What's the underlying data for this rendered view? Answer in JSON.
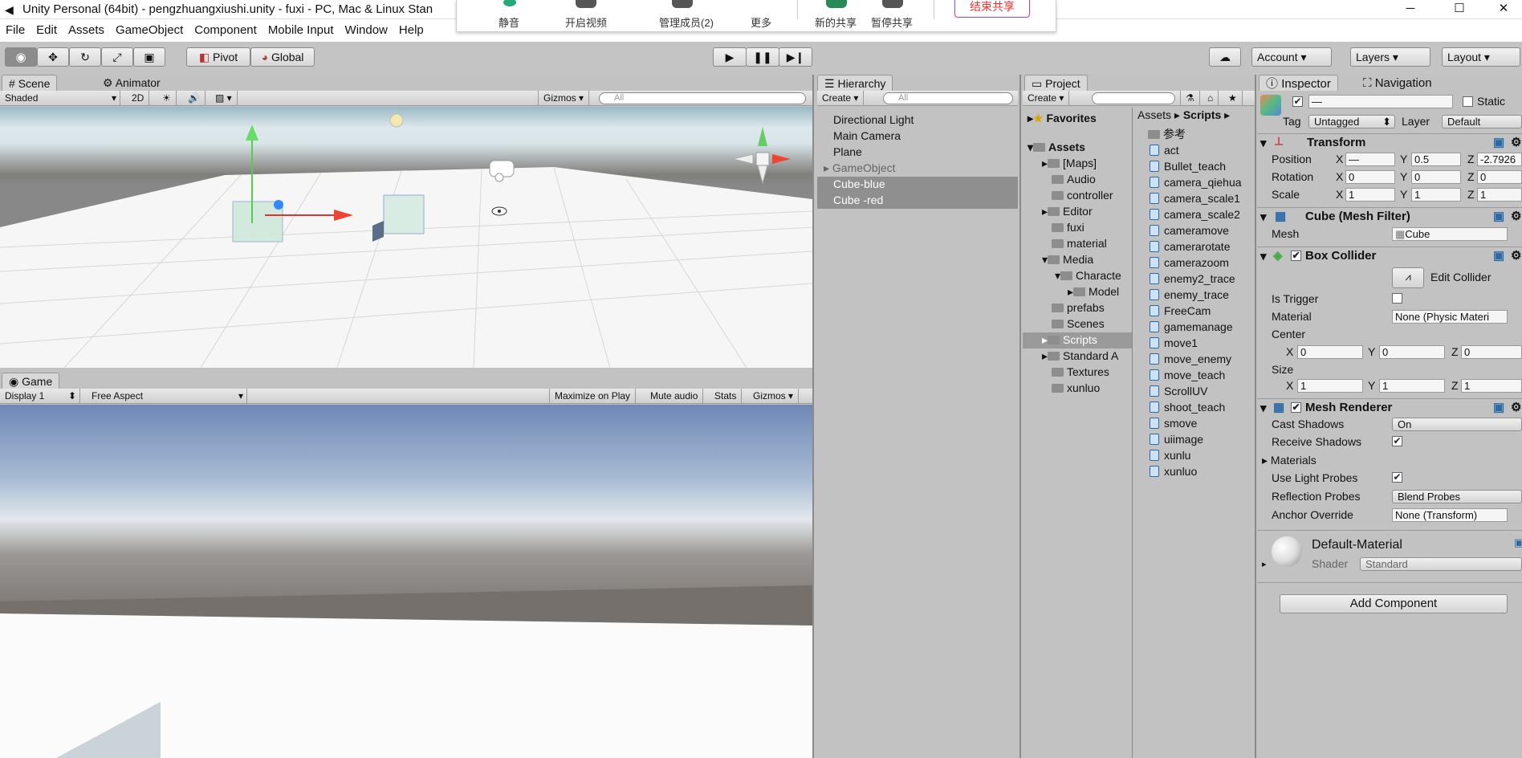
{
  "window": {
    "title": "Unity Personal (64bit) - pengzhuangxiushi.unity - fuxi - PC, Mac & Linux Stan",
    "minimize": "─",
    "maximize": "☐",
    "close": "✕"
  },
  "menu": [
    "File",
    "Edit",
    "Assets",
    "GameObject",
    "Component",
    "Mobile Input",
    "Window",
    "Help"
  ],
  "meeting": {
    "mute": "静音",
    "video": "开启视频",
    "members": "管理成员(2)",
    "more": "更多",
    "new_share": "新的共享",
    "pause_share": "暂停共享",
    "end_share": "结束共享"
  },
  "toolbar": {
    "pivot": "Pivot",
    "global": "Global",
    "account": "Account",
    "layers": "Layers",
    "layout": "Layout",
    "cloud_icon": "cloud-icon"
  },
  "scene": {
    "tab": "Scene",
    "animator_tab": "Animator",
    "shading": "Shaded",
    "mode2d": "2D",
    "gizmos": "Gizmos",
    "search_placeholder": "All"
  },
  "game": {
    "tab": "Game",
    "display": "Display 1",
    "aspect": "Free Aspect",
    "maximize": "Maximize on Play",
    "mute": "Mute audio",
    "stats": "Stats",
    "gizmos": "Gizmos"
  },
  "hierarchy": {
    "tab": "Hierarchy",
    "create": "Create",
    "search_placeholder": "All",
    "items": [
      "Directional Light",
      "Main Camera",
      "Plane",
      "GameObject",
      "Cube-blue",
      "Cube -red"
    ]
  },
  "project": {
    "tab": "Project",
    "create": "Create",
    "favorites": "Favorites",
    "assets": "Assets",
    "folders": [
      "[Maps]",
      "Audio",
      "controller",
      "Editor",
      "fuxi",
      "material",
      "Media",
      "Characte",
      "Model",
      "prefabs",
      "Scenes",
      "Scripts",
      "Standard A",
      "Textures",
      "xunluo"
    ],
    "breadcrumb": [
      "Assets",
      "Scripts"
    ],
    "files": [
      "参考",
      "act",
      "Bullet_teach",
      "camera_qiehua",
      "camera_scale1",
      "camera_scale2",
      "cameramove",
      "camerarotate",
      "camerazoom",
      "enemy2_trace",
      "enemy_trace",
      "FreeCam",
      "gamemanage",
      "move1",
      "move_enemy",
      "move_teach",
      "ScrollUV",
      "shoot_teach",
      "smove",
      "uiimage",
      "xunlu",
      "xunluo"
    ]
  },
  "inspector": {
    "tab": "Inspector",
    "nav_tab": "Navigation",
    "name_value": "—",
    "static": "Static",
    "tag_label": "Tag",
    "tag": "Untagged",
    "layer_label": "Layer",
    "layer": "Default",
    "transform": {
      "title": "Transform",
      "position": "Position",
      "rotation": "Rotation",
      "scale": "Scale",
      "pos": [
        "—",
        "0.5",
        "-2.7926"
      ],
      "rot": [
        "0",
        "0",
        "0"
      ],
      "scl": [
        "1",
        "1",
        "1"
      ]
    },
    "meshfilter": {
      "title": "Cube (Mesh Filter)",
      "mesh_label": "Mesh",
      "mesh": "Cube"
    },
    "boxcollider": {
      "title": "Box Collider",
      "edit": "Edit Collider",
      "is_trigger": "Is Trigger",
      "material_label": "Material",
      "material": "None (Physic Materi",
      "center": "Center",
      "size": "Size",
      "center_v": [
        "0",
        "0",
        "0"
      ],
      "size_v": [
        "1",
        "1",
        "1"
      ]
    },
    "meshrenderer": {
      "title": "Mesh Renderer",
      "cast": "Cast Shadows",
      "cast_v": "On",
      "receive": "Receive Shadows",
      "materials": "Materials",
      "probes": "Use Light Probes",
      "reflection": "Reflection Probes",
      "reflection_v": "Blend Probes",
      "anchor": "Anchor Override",
      "anchor_v": "None (Transform)"
    },
    "material": {
      "name": "Default-Material",
      "shader_label": "Shader",
      "shader": "Standard"
    },
    "add_component": "Add Component"
  },
  "axes": [
    "X",
    "Y",
    "Z"
  ]
}
